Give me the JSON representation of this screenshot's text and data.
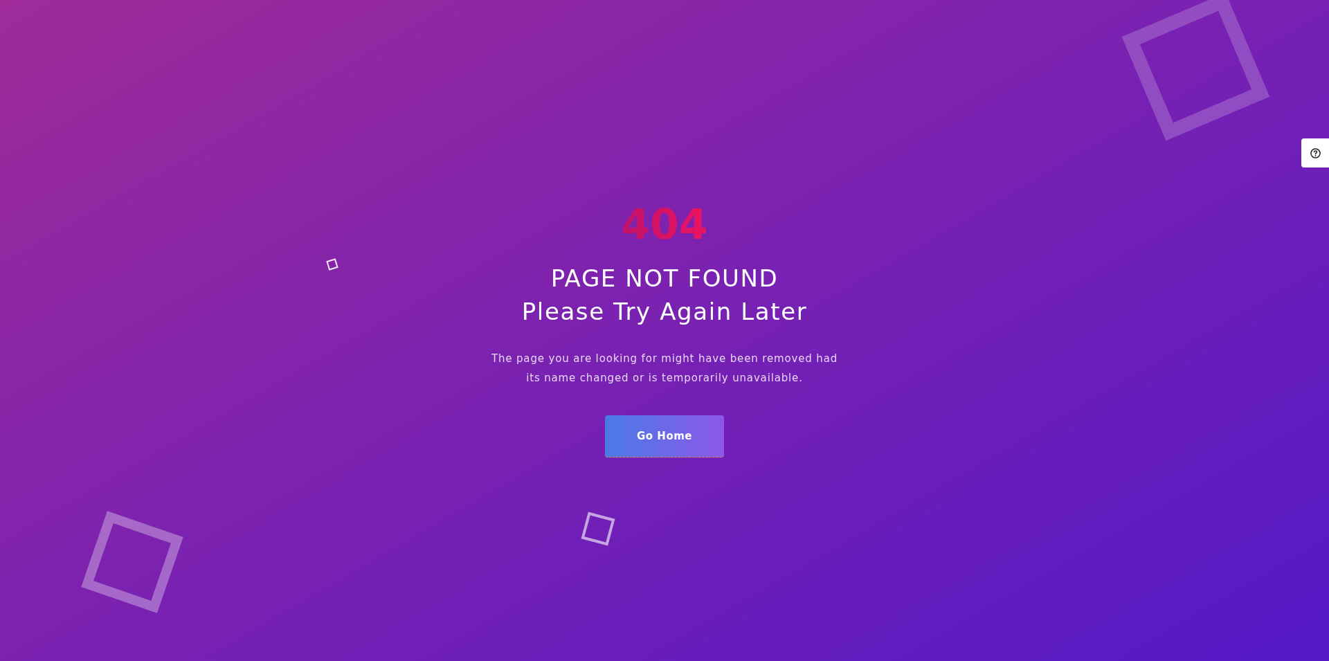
{
  "error_code": "404",
  "heading": {
    "title": "PAGE NOT FOUND",
    "subtitle": "Please Try Again Later"
  },
  "message": "The page you are looking for might have been removed had its name changed or is temporarily unavailable.",
  "button": {
    "label": "Go Home"
  }
}
